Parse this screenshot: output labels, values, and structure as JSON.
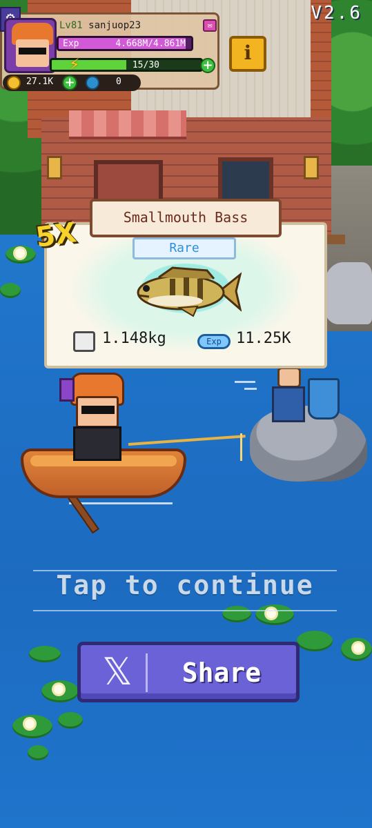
{
  "hud": {
    "version": "V2.6",
    "level": "Lv81",
    "username": "sanjuop23",
    "exp_label": "Exp",
    "exp_value": "4.668M/4.861M",
    "exp_fraction": 0.96,
    "energy_value": "15/30",
    "energy_fraction": 0.5,
    "coins": "27.1K",
    "gems": "0",
    "info_label": "i",
    "settings_icon": "gear-icon"
  },
  "catch": {
    "multiplier": "5X",
    "fish_name": "Smallmouth Bass",
    "rarity": "Rare",
    "weight": "1.148kg",
    "exp_badge": "Exp",
    "exp_gain": "11.25K"
  },
  "prompt": {
    "tap_to_continue": "Tap to continue",
    "share_label": "Share",
    "share_icon": "x-logo-icon"
  },
  "colors": {
    "water": "#1f73c8",
    "share_button": "#6b62d8",
    "card_bg": "#fbf6ea",
    "rarity_text": "#2e8fd9",
    "multiplier": "#f7d12c"
  }
}
